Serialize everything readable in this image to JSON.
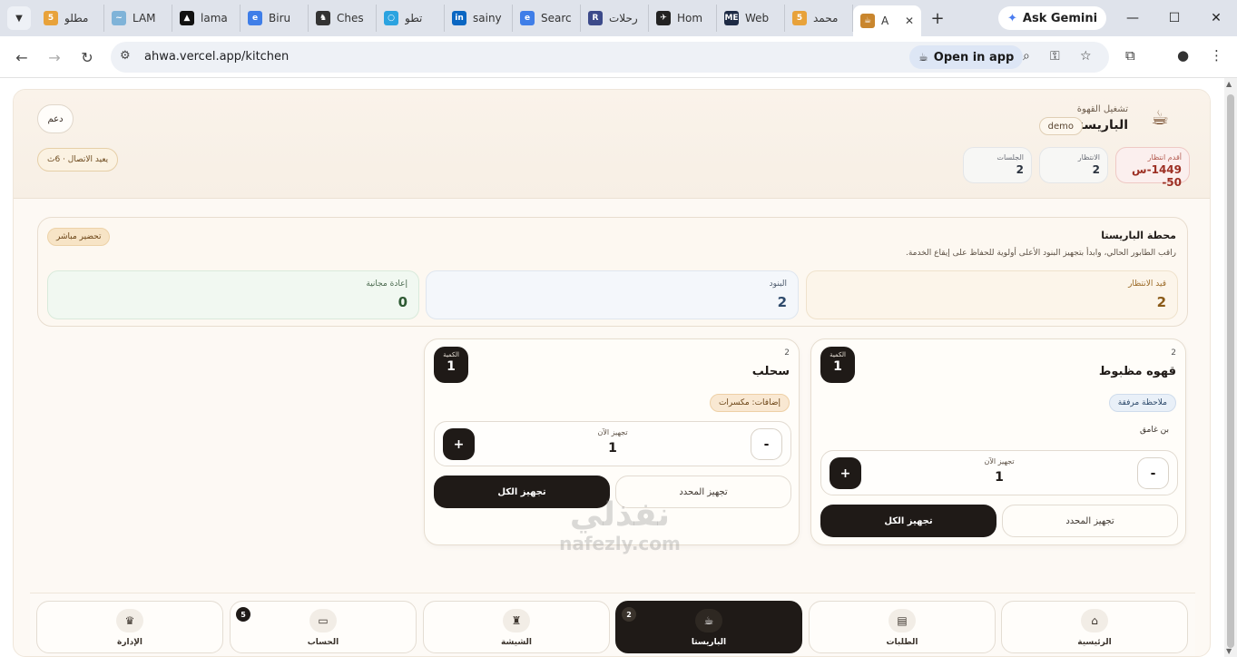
{
  "browser": {
    "tabs": [
      {
        "label": "مطلو",
        "fav": "5",
        "color": "#e8a23a"
      },
      {
        "label": "LAM",
        "fav": "~",
        "color": "#7fb3d8"
      },
      {
        "label": "lama",
        "fav": "▲",
        "color": "#111111"
      },
      {
        "label": "Biru",
        "fav": "e",
        "color": "#3f7ee8"
      },
      {
        "label": "Ches",
        "fav": "♞",
        "color": "#333333"
      },
      {
        "label": "تطو",
        "fav": "○",
        "color": "#2ba3e0"
      },
      {
        "label": "sainy",
        "fav": "in",
        "color": "#0a66c2"
      },
      {
        "label": "Searc",
        "fav": "e",
        "color": "#3f7ee8"
      },
      {
        "label": "رحلات",
        "fav": "R",
        "color": "#3c4a8a"
      },
      {
        "label": "Hom",
        "fav": "✈",
        "color": "#222222"
      },
      {
        "label": "Web",
        "fav": "ME",
        "color": "#1d2a44"
      },
      {
        "label": "محمد",
        "fav": "5",
        "color": "#e8a23a"
      },
      {
        "label": "A",
        "fav": "☕",
        "color": "#c9862e"
      }
    ],
    "gemini_label": "Ask Gemini",
    "url": "ahwa.vercel.app/kitchen",
    "open_in_app": "Open in app",
    "window_min": "—",
    "window_max": "☐",
    "window_close": "✕"
  },
  "header": {
    "brand_sub": "تشغيل القهوة",
    "brand_title": "الباريستا",
    "demo": "demo",
    "support": "دعم",
    "reconnect": "يعيد الاتصال · 6ث",
    "stats": [
      {
        "label": "أقدم انتظار",
        "value": "1449-س 50-"
      },
      {
        "label": "الانتظار",
        "value": "2"
      },
      {
        "label": "الجلسات",
        "value": "2"
      }
    ]
  },
  "station": {
    "title": "محطة الباريستا",
    "description": "راقب الطابور الحالي، وابدأ بتجهيز البنود الأعلى أولوية للحفاظ على إيقاع الخدمة.",
    "live": "تحضير مباشر",
    "metrics": {
      "waiting_label": "قيد الانتظار",
      "waiting_value": "2",
      "items_label": "البنود",
      "items_value": "2",
      "remake_label": "إعادة مجانية",
      "remake_value": "0"
    }
  },
  "cards": [
    {
      "order": "2",
      "name": "قهوه مظبوط",
      "qty_label": "الكمية",
      "qty": "1",
      "note_chip": "ملاحظة مرفقة",
      "note_text": "بن غامق",
      "step_label": "تجهيز الآن",
      "step_value": "1",
      "plus": "+",
      "minus": "-",
      "ready_all": "تجهيز الكل",
      "ready_selected": "تجهيز المحدد"
    },
    {
      "order": "2",
      "name": "سحلب",
      "qty_label": "الكمية",
      "qty": "1",
      "note_chip": "إضافات: مكسرات",
      "step_label": "تجهيز الآن",
      "step_value": "1",
      "plus": "+",
      "minus": "-",
      "ready_all": "تجهيز الكل",
      "ready_selected": "تجهيز المحدد"
    }
  ],
  "nav": {
    "home": "الرئيسية",
    "orders": "الطلبات",
    "barista": "الباريستا",
    "barista_badge": "2",
    "shisha": "الشيشة",
    "account": "الحساب",
    "account_badge": "5",
    "admin": "الإدارة"
  },
  "watermark": {
    "line1": "نفذلي",
    "line2": "nafezly.com"
  }
}
